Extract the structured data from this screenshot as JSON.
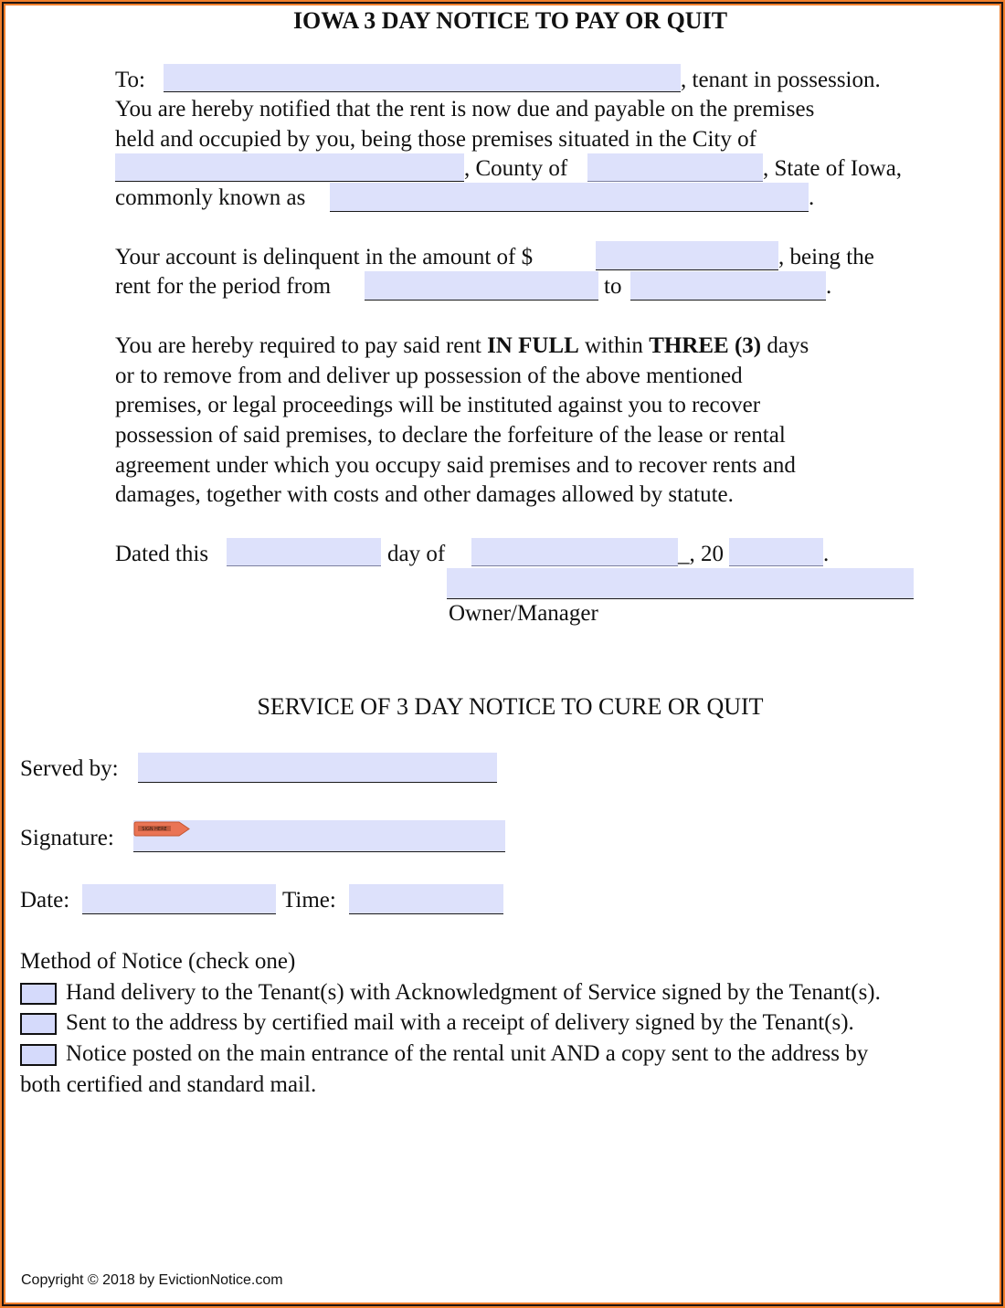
{
  "document": {
    "title": "IOWA 3 DAY NOTICE TO PAY OR QUIT",
    "notice": {
      "to_label": "To:",
      "tenant_suffix": ", tenant in possession.",
      "line2": "You are hereby notified that the rent is now due and payable on the premises",
      "line3": "held and occupied by you, being those premises situated in the City of",
      "county_label": ", County of",
      "state_label": ", State of Iowa,",
      "known_as_label": "commonly known as",
      "period_end": "."
    },
    "account": {
      "amount_label": "Your account is delinquent in the amount of $",
      "being_label": ", being the",
      "period_label": "rent for the period from",
      "to_label": "to",
      "end": "."
    },
    "requirement": {
      "line1_a": "You are hereby required to pay said rent ",
      "line1_bold1": "IN FULL",
      "line1_b": " within ",
      "line1_bold2": "THREE (3)",
      "line1_c": " days",
      "lines": [
        "or to remove from and deliver up possession of the above mentioned",
        "premises, or legal proceedings will be instituted against you to recover",
        "possession of said premises, to declare the forfeiture of the lease or rental",
        "agreement under which you occupy said premises and to recover rents and",
        "damages, together with costs and other damages allowed by statute."
      ]
    },
    "dated": {
      "dated_label": "Dated this",
      "day_of_label": "day of",
      "year_prefix": "_, 20",
      "end": ".",
      "signer_label": "Owner/Manager"
    },
    "fields": {
      "tenant_name": "",
      "city": "",
      "county": "",
      "address": "",
      "amount": "",
      "period_from": "",
      "period_to": "",
      "day": "",
      "month": "",
      "year": "",
      "owner_signature": "",
      "served_by": "",
      "signature": "",
      "date": "",
      "time": ""
    }
  },
  "service": {
    "title": "SERVICE OF 3 DAY NOTICE TO CURE OR QUIT",
    "served_by_label": "Served by:",
    "signature_label": "Signature:",
    "sign_here_tag": "SIGN HERE",
    "date_label": "Date:",
    "time_label": "Time:",
    "method_label": "Method of Notice (check one)",
    "methods": [
      {
        "label": "Hand delivery to the Tenant(s) with Acknowledgment of Service signed by the Tenant(s).",
        "checked": false
      },
      {
        "label": "Sent to the address by certified mail with a receipt of delivery signed by the Tenant(s).",
        "checked": false
      },
      {
        "label": "Notice posted on the main entrance of the rental unit AND a copy sent to the address by",
        "label_cont": "both certified and standard mail.",
        "checked": false
      }
    ]
  },
  "footer": {
    "copyright": "Copyright © 2018 by EvictionNotice.com"
  },
  "colors": {
    "frame": "#f07f2c",
    "field_fill": "#dde1fb"
  }
}
